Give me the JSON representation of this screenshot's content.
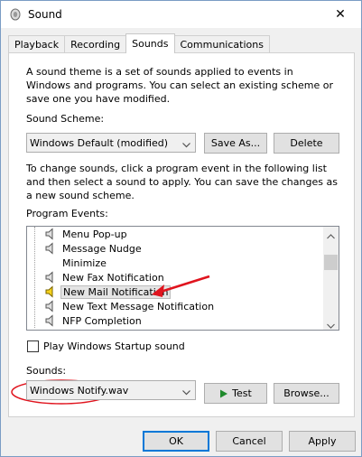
{
  "window": {
    "title": "Sound",
    "close_symbol": "✕"
  },
  "tabs": [
    {
      "label": "Playback",
      "active": false
    },
    {
      "label": "Recording",
      "active": false
    },
    {
      "label": "Sounds",
      "active": true
    },
    {
      "label": "Communications",
      "active": false
    }
  ],
  "sounds_tab": {
    "intro_text": "A sound theme is a set of sounds applied to events in Windows and programs.  You can select an existing scheme or save one you have modified.",
    "scheme_label": "Sound Scheme:",
    "scheme_value": "Windows Default (modified)",
    "save_as_label": "Save As...",
    "delete_label": "Delete",
    "change_text": "To change sounds, click a program event in the following list and then select a sound to apply.  You can save the changes as a new sound scheme.",
    "program_events_label": "Program Events:",
    "events": [
      {
        "label": "Menu Pop-up",
        "has_sound": false,
        "selected": false
      },
      {
        "label": "Message Nudge",
        "has_sound": false,
        "selected": false
      },
      {
        "label": "Minimize",
        "has_sound": false,
        "selected": false
      },
      {
        "label": "New Fax Notification",
        "has_sound": false,
        "selected": false
      },
      {
        "label": "New Mail Notification",
        "has_sound": true,
        "selected": true
      },
      {
        "label": "New Text Message Notification",
        "has_sound": false,
        "selected": false
      },
      {
        "label": "NFP Completion",
        "has_sound": false,
        "selected": false
      }
    ],
    "startup_checkbox_label": "Play Windows Startup sound",
    "startup_checked": false,
    "sounds_label": "Sounds:",
    "sound_value": "Windows Notify.wav",
    "test_label": "Test",
    "browse_label": "Browse..."
  },
  "footer": {
    "ok_label": "OK",
    "cancel_label": "Cancel",
    "apply_label": "Apply"
  },
  "annotation_color": "#e0141e",
  "accent_color": "#0078d7"
}
